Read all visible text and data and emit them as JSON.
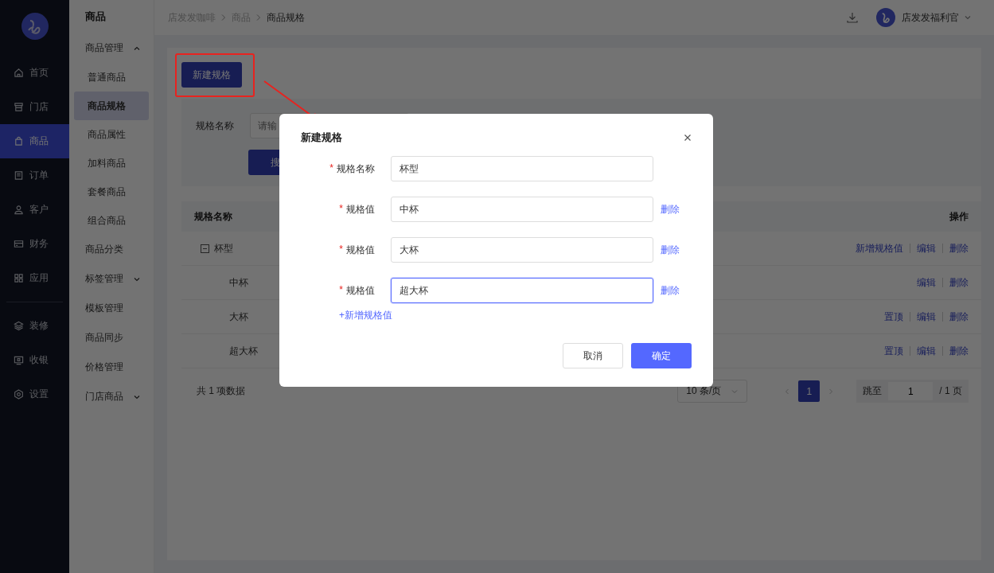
{
  "nav": {
    "primary": [
      {
        "label": "首页",
        "selected": false
      },
      {
        "label": "门店",
        "selected": false
      },
      {
        "label": "商品",
        "selected": true
      },
      {
        "label": "订单",
        "selected": false
      },
      {
        "label": "客户",
        "selected": false
      },
      {
        "label": "财务",
        "selected": false
      },
      {
        "label": "应用",
        "selected": false
      }
    ],
    "secondary": [
      {
        "label": "装修",
        "selected": false
      },
      {
        "label": "收银",
        "selected": false
      },
      {
        "label": "设置",
        "selected": false
      }
    ]
  },
  "submenu": {
    "title": "商品",
    "items": [
      {
        "label": "商品管理",
        "selected": false,
        "expanded": true,
        "children": [
          {
            "label": "普通商品",
            "selected": false
          },
          {
            "label": "商品规格",
            "selected": true
          },
          {
            "label": "商品属性",
            "selected": false
          },
          {
            "label": "加料商品",
            "selected": false
          },
          {
            "label": "套餐商品",
            "selected": false
          },
          {
            "label": "组合商品",
            "selected": false
          }
        ]
      },
      {
        "label": "商品分类",
        "selected": false
      },
      {
        "label": "标签管理",
        "selected": false,
        "expanded": false
      },
      {
        "label": "模板管理",
        "selected": false
      },
      {
        "label": "商品同步",
        "selected": false
      },
      {
        "label": "价格管理",
        "selected": false
      },
      {
        "label": "门店商品",
        "selected": false,
        "expanded": false
      }
    ]
  },
  "breadcrumb": [
    "店发发咖啡",
    "商品",
    "商品规格"
  ],
  "user": {
    "name": "店发发福利官"
  },
  "new_button": "新建规格",
  "search": {
    "label": "规格名称",
    "placeholder": "请输",
    "button": "搜"
  },
  "table": {
    "columns": [
      "规格名称",
      "操作"
    ],
    "rows": [
      {
        "name": "杯型",
        "expanded": true,
        "actions": [
          "新增规格值",
          "编辑",
          "删除"
        ],
        "children": [
          {
            "name": "中杯",
            "actions": [
              "编辑",
              "删除"
            ]
          },
          {
            "name": "大杯",
            "actions": [
              "置顶",
              "编辑",
              "删除"
            ]
          },
          {
            "name": "超大杯",
            "actions": [
              "置顶",
              "编辑",
              "删除"
            ]
          }
        ]
      }
    ]
  },
  "pagination": {
    "total": "共 1 项数据",
    "page_size": "10 条/页",
    "pages": [
      {
        "label": "1",
        "selected": true
      }
    ],
    "jump_label": "跳至",
    "jump_value": "1",
    "page_count": "/ 1 页"
  },
  "dialog": {
    "title": "新建规格",
    "fields": [
      {
        "label": "规格名称",
        "value": "杯型",
        "required_mark": "*",
        "focused": false
      },
      {
        "label": "规格值",
        "value": "中杯",
        "required_mark": "*",
        "focused": false,
        "delete": "删除"
      },
      {
        "label": "规格值",
        "value": "大杯",
        "required_mark": "*",
        "focused": false,
        "delete": "删除"
      },
      {
        "label": "规格值",
        "value": "超大杯",
        "required_mark": "*",
        "focused": true,
        "delete": "删除"
      }
    ],
    "add_link": "+新增规格值",
    "cancel": "取消",
    "ok": "确定"
  }
}
